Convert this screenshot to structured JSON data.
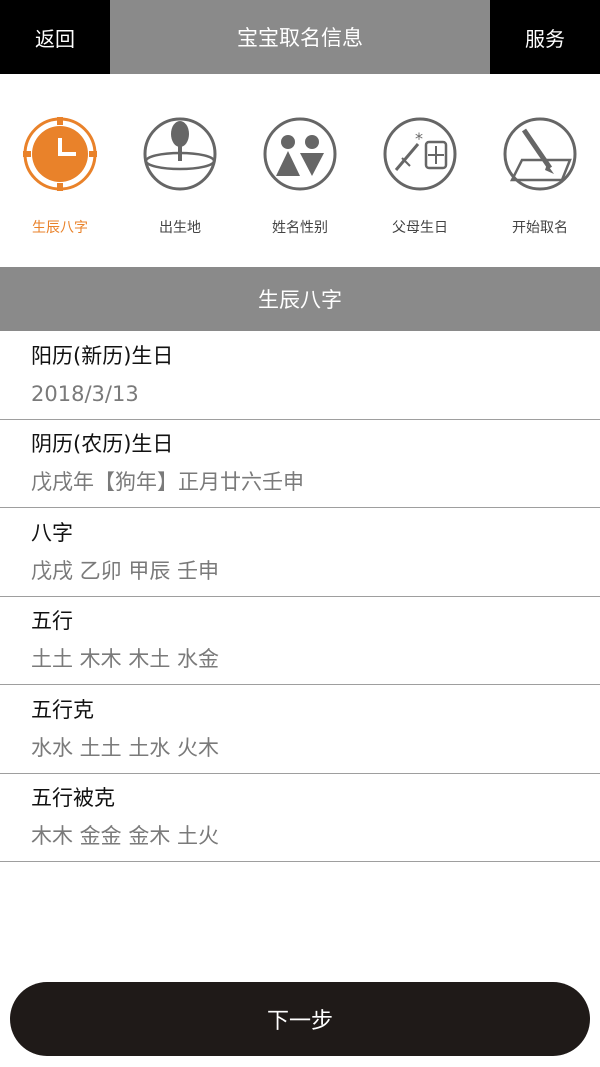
{
  "topbar": {
    "back_label": "返回",
    "title": "宝宝取名信息",
    "service_label": "服务"
  },
  "steps": [
    {
      "label": "生辰八字",
      "icon": "clock-icon",
      "active": true
    },
    {
      "label": "出生地",
      "icon": "map-pin-icon",
      "active": false
    },
    {
      "label": "姓名性别",
      "icon": "gender-icon",
      "active": false
    },
    {
      "label": "父母生日",
      "icon": "calendar-icon",
      "active": false
    },
    {
      "label": "开始取名",
      "icon": "pen-icon",
      "active": false
    }
  ],
  "colors": {
    "accent": "#e9822a",
    "inactive": "#666666",
    "header_gray": "#8a8a8a",
    "button_dark": "#1f1a18"
  },
  "section": {
    "title": "生辰八字"
  },
  "info": [
    {
      "label": "阳历(新历)生日",
      "value": "2018/3/13"
    },
    {
      "label": "阴历(农历)生日",
      "value": "戊戌年【狗年】正月廿六壬申"
    },
    {
      "label": "八字",
      "value": "戊戌 乙卯 甲辰 壬申"
    },
    {
      "label": "五行",
      "value": "土土 木木 木土 水金"
    },
    {
      "label": "五行克",
      "value": "水水 土土 土水 火木"
    },
    {
      "label": "五行被克",
      "value": "木木 金金 金木 土火"
    }
  ],
  "next_button": {
    "label": "下一步"
  }
}
